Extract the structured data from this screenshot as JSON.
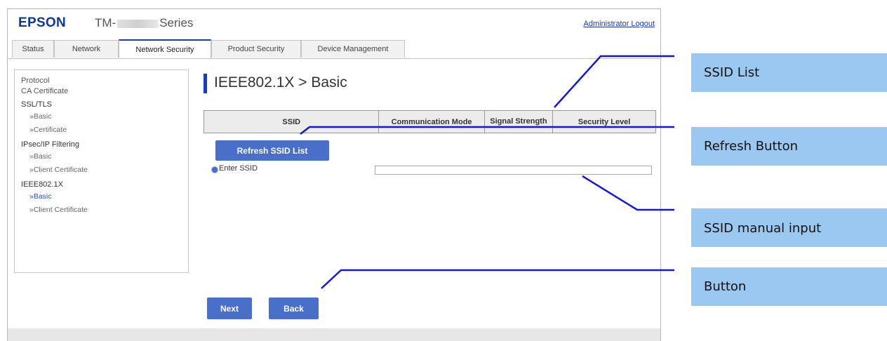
{
  "header": {
    "logo": "EPSON",
    "model_prefix": "TM-",
    "model_suffix": "Series",
    "logout": "Administrator Logout"
  },
  "tabs": [
    {
      "label": "Status",
      "active": false
    },
    {
      "label": "Network",
      "active": false
    },
    {
      "label": "Network Security",
      "active": true
    },
    {
      "label": "Product Security",
      "active": false
    },
    {
      "label": "Device Management",
      "active": false
    }
  ],
  "sidebar": {
    "protocol": "Protocol",
    "ca_certificate": "CA Certificate",
    "ssl_tls": "SSL/TLS",
    "ssl_basic": "»Basic",
    "ssl_certificate": "»Certificate",
    "ipsec": "IPsec/IP Filtering",
    "ipsec_basic": "»Basic",
    "ipsec_client_cert": "»Client Certificate",
    "ieee": "IEEE802.1X",
    "ieee_basic": "»Basic",
    "ieee_client_cert": "»Client Certificate"
  },
  "main": {
    "title": "IEEE802.1X > Basic",
    "table_headers": [
      "SSID",
      "Communication Mode",
      "Signal Strength",
      "Security Level"
    ],
    "refresh_button": "Refresh SSID List",
    "enter_ssid_label": "Enter SSID",
    "ssid_value": "",
    "next_button": "Next",
    "back_button": "Back"
  },
  "callouts": {
    "ssid_list": "SSID List",
    "refresh_button": "Refresh Button",
    "ssid_manual_input": "SSID manual input",
    "button": "Button"
  },
  "colors": {
    "accent": "#1d3fae",
    "button": "#4a6fc9",
    "callout_bg": "#9bc8f1",
    "leader_line": "#1616d8"
  }
}
